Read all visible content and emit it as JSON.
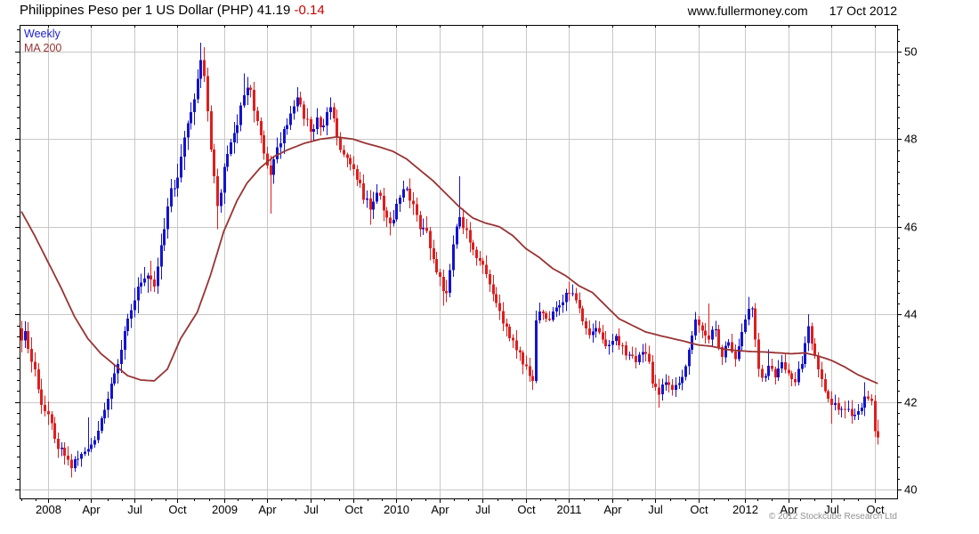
{
  "header": {
    "title": "Philippines Peso per 1 US Dollar (PHP)",
    "last_price": "41.19",
    "change": "-0.14",
    "site": "www.fullermoney.com",
    "date": "17 Oct 2012"
  },
  "legend": {
    "timeframe": "Weekly",
    "ma_label": "MA 200"
  },
  "footer": {
    "copyright": "© 2012 Stockcube Research Ltd"
  },
  "colors": {
    "up": "#1414cc",
    "down": "#dd1f1f",
    "ma": "#993333",
    "grid": "#c8c8c8",
    "axis": "#000000",
    "text": "#000000",
    "change": "#cc0000",
    "weekly_label": "#2020cc",
    "copyright": "#909090"
  },
  "chart_data": {
    "type": "candlestick",
    "title": "Philippines Peso per 1 US Dollar (PHP)",
    "timeframe": "weekly",
    "overlay": "MA 200",
    "last_close": 41.19,
    "prev_close": 41.33,
    "change": -0.14,
    "ylim": [
      39.8,
      50.6
    ],
    "y_ticks": [
      40,
      42,
      44,
      46,
      48,
      50
    ],
    "y_minor_step": 0.25,
    "grid": true,
    "weeks": 259,
    "x_ticks": [
      [
        8,
        "2008"
      ],
      [
        21,
        "Apr"
      ],
      [
        34,
        "Jul"
      ],
      [
        47,
        "Oct"
      ],
      [
        61,
        "2009"
      ],
      [
        74,
        "Apr"
      ],
      [
        87,
        "Jul"
      ],
      [
        100,
        "Oct"
      ],
      [
        113,
        "2010"
      ],
      [
        126,
        "Apr"
      ],
      [
        139,
        "Jul"
      ],
      [
        152,
        "Oct"
      ],
      [
        165,
        "2011"
      ],
      [
        178,
        "Apr"
      ],
      [
        191,
        "Jul"
      ],
      [
        204,
        "Oct"
      ],
      [
        218,
        "2012"
      ],
      [
        231,
        "Apr"
      ],
      [
        244,
        "Jul"
      ],
      [
        257,
        "Oct"
      ]
    ],
    "close_anchors": [
      [
        0,
        43.4
      ],
      [
        1,
        43.6,
        43.8
      ],
      [
        3,
        42.9
      ],
      [
        5,
        42.3
      ],
      [
        7,
        41.8
      ],
      [
        9,
        41.5
      ],
      [
        11,
        40.95
      ],
      [
        13,
        40.8
      ],
      [
        15,
        40.5,
        null,
        40.27
      ],
      [
        17,
        40.7
      ],
      [
        20,
        40.9,
        41.65
      ],
      [
        22,
        41.15
      ],
      [
        24,
        41.6
      ],
      [
        26,
        42.1
      ],
      [
        28,
        42.65
      ],
      [
        30,
        43.2
      ],
      [
        32,
        43.9
      ],
      [
        34,
        44.35
      ],
      [
        36,
        44.7
      ],
      [
        38,
        44.85
      ],
      [
        40,
        44.6
      ],
      [
        42,
        45.6
      ],
      [
        44,
        46.5
      ],
      [
        46,
        46.9
      ],
      [
        48,
        47.6
      ],
      [
        50,
        48.4
      ],
      [
        52,
        48.9
      ],
      [
        54,
        49.8,
        50.2
      ],
      [
        55,
        49.4,
        50.1
      ],
      [
        57,
        47.8
      ],
      [
        59,
        46.5,
        null,
        45.95
      ],
      [
        61,
        47.4
      ],
      [
        63,
        47.9
      ],
      [
        65,
        48.3
      ],
      [
        67,
        49.0,
        49.5
      ],
      [
        69,
        49.15
      ],
      [
        71,
        48.4
      ],
      [
        73,
        47.7
      ],
      [
        75,
        47.2,
        null,
        46.3
      ],
      [
        77,
        47.8
      ],
      [
        79,
        48.25
      ],
      [
        81,
        48.6
      ],
      [
        83,
        48.95,
        49.15
      ],
      [
        85,
        48.5
      ],
      [
        87,
        48.15
      ],
      [
        89,
        48.5
      ],
      [
        91,
        48.3
      ],
      [
        93,
        48.7,
        48.95
      ],
      [
        95,
        48.05
      ],
      [
        97,
        47.65
      ],
      [
        99,
        47.4
      ],
      [
        101,
        47.1
      ],
      [
        103,
        46.65
      ],
      [
        105,
        46.4,
        null,
        46.05
      ],
      [
        107,
        46.75
      ],
      [
        109,
        46.4
      ],
      [
        111,
        46.05,
        null,
        45.8
      ],
      [
        113,
        46.55
      ],
      [
        115,
        46.85,
        47.05
      ],
      [
        117,
        46.6
      ],
      [
        119,
        46.25
      ],
      [
        121,
        45.95
      ],
      [
        123,
        45.55
      ],
      [
        125,
        45.0
      ],
      [
        127,
        44.55,
        null,
        44.2
      ],
      [
        128,
        44.5
      ],
      [
        130,
        45.6
      ],
      [
        132,
        46.25,
        47.15
      ],
      [
        134,
        45.9
      ],
      [
        136,
        45.5
      ],
      [
        138,
        45.2
      ],
      [
        140,
        44.9
      ],
      [
        142,
        44.45
      ],
      [
        144,
        44.1
      ],
      [
        146,
        43.75
      ],
      [
        148,
        43.4
      ],
      [
        150,
        43.1
      ],
      [
        152,
        42.8
      ],
      [
        154,
        42.5,
        null,
        42.28
      ],
      [
        155,
        43.85
      ],
      [
        157,
        44.05
      ],
      [
        159,
        43.9
      ],
      [
        161,
        44.15
      ],
      [
        163,
        44.3
      ],
      [
        165,
        44.5,
        44.75
      ],
      [
        167,
        44.35
      ],
      [
        169,
        43.85
      ],
      [
        171,
        43.55
      ],
      [
        173,
        43.7
      ],
      [
        175,
        43.45
      ],
      [
        177,
        43.3
      ],
      [
        179,
        43.5
      ],
      [
        181,
        43.3
      ],
      [
        183,
        43.05
      ],
      [
        185,
        42.9
      ],
      [
        187,
        43.15
      ],
      [
        189,
        42.9
      ],
      [
        190,
        42.4
      ],
      [
        192,
        42.15,
        null,
        41.87
      ],
      [
        194,
        42.45
      ],
      [
        196,
        42.3
      ],
      [
        198,
        42.45
      ],
      [
        200,
        42.8
      ],
      [
        202,
        43.5
      ],
      [
        203,
        43.9,
        44.05
      ],
      [
        205,
        43.6
      ],
      [
        207,
        43.45,
        44.25
      ],
      [
        209,
        43.65
      ],
      [
        211,
        43.05
      ],
      [
        213,
        43.35
      ],
      [
        215,
        42.95
      ],
      [
        217,
        43.6
      ],
      [
        219,
        44.1,
        44.4
      ],
      [
        220,
        44.15
      ],
      [
        221,
        43.45
      ],
      [
        222,
        42.75
      ],
      [
        223,
        42.55
      ],
      [
        225,
        42.8,
        43.2
      ],
      [
        227,
        42.55
      ],
      [
        229,
        42.9
      ],
      [
        231,
        42.65
      ],
      [
        233,
        42.45
      ],
      [
        235,
        42.85
      ],
      [
        237,
        43.75,
        44.0
      ],
      [
        238,
        43.35
      ],
      [
        240,
        42.75
      ],
      [
        242,
        42.25
      ],
      [
        244,
        41.95,
        null,
        41.5
      ],
      [
        246,
        41.8
      ],
      [
        248,
        41.85
      ],
      [
        250,
        41.7
      ],
      [
        252,
        41.8
      ],
      [
        254,
        42.15,
        42.45
      ],
      [
        256,
        42.0
      ],
      [
        257,
        41.33,
        null,
        41.2
      ],
      [
        258,
        41.19,
        41.6,
        41.05
      ]
    ],
    "ma_anchors": [
      [
        0,
        46.35
      ],
      [
        4,
        45.8
      ],
      [
        8,
        45.2
      ],
      [
        12,
        44.6
      ],
      [
        16,
        43.95
      ],
      [
        20,
        43.45
      ],
      [
        24,
        43.1
      ],
      [
        28,
        42.85
      ],
      [
        32,
        42.6
      ],
      [
        36,
        42.5
      ],
      [
        40,
        42.48
      ],
      [
        44,
        42.75
      ],
      [
        48,
        43.45
      ],
      [
        53,
        44.05
      ],
      [
        57,
        44.9
      ],
      [
        61,
        45.9
      ],
      [
        65,
        46.6
      ],
      [
        68,
        47.0
      ],
      [
        72,
        47.35
      ],
      [
        76,
        47.6
      ],
      [
        80,
        47.75
      ],
      [
        85,
        47.9
      ],
      [
        90,
        48.0
      ],
      [
        95,
        48.05
      ],
      [
        100,
        48.0
      ],
      [
        104,
        47.9
      ],
      [
        108,
        47.82
      ],
      [
        112,
        47.72
      ],
      [
        116,
        47.55
      ],
      [
        120,
        47.3
      ],
      [
        124,
        47.05
      ],
      [
        128,
        46.75
      ],
      [
        132,
        46.45
      ],
      [
        136,
        46.2
      ],
      [
        140,
        46.08
      ],
      [
        144,
        46.0
      ],
      [
        148,
        45.8
      ],
      [
        152,
        45.5
      ],
      [
        156,
        45.3
      ],
      [
        160,
        45.05
      ],
      [
        164,
        44.88
      ],
      [
        168,
        44.65
      ],
      [
        172,
        44.5
      ],
      [
        176,
        44.2
      ],
      [
        180,
        43.9
      ],
      [
        184,
        43.75
      ],
      [
        188,
        43.6
      ],
      [
        192,
        43.52
      ],
      [
        196,
        43.45
      ],
      [
        200,
        43.38
      ],
      [
        204,
        43.3
      ],
      [
        208,
        43.27
      ],
      [
        212,
        43.2
      ],
      [
        216,
        43.17
      ],
      [
        220,
        43.15
      ],
      [
        224,
        43.14
      ],
      [
        228,
        43.12
      ],
      [
        232,
        43.1
      ],
      [
        236,
        43.12
      ],
      [
        240,
        43.05
      ],
      [
        244,
        42.95
      ],
      [
        248,
        42.8
      ],
      [
        252,
        42.62
      ],
      [
        258,
        42.42
      ]
    ],
    "vol_anchors": [
      [
        0,
        0.32
      ],
      [
        18,
        0.22
      ],
      [
        40,
        0.4
      ],
      [
        60,
        0.35
      ],
      [
        75,
        0.3
      ],
      [
        96,
        0.25
      ],
      [
        110,
        0.28
      ],
      [
        122,
        0.32
      ],
      [
        135,
        0.25
      ],
      [
        150,
        0.28
      ],
      [
        160,
        0.22
      ],
      [
        185,
        0.25
      ],
      [
        200,
        0.22
      ],
      [
        216,
        0.24
      ],
      [
        258,
        0.22
      ]
    ]
  }
}
